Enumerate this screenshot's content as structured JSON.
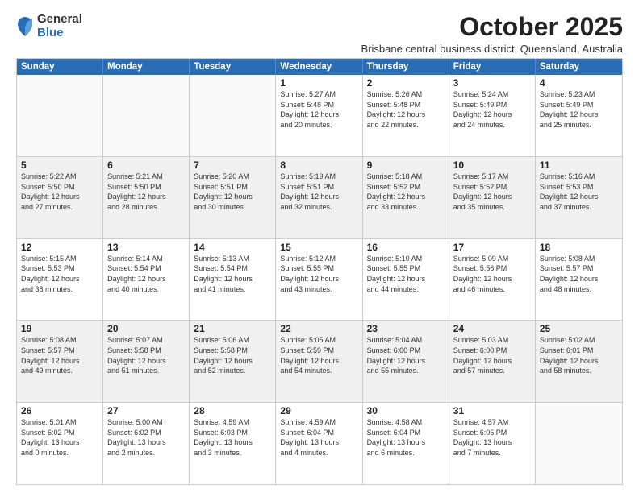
{
  "logo": {
    "general": "General",
    "blue": "Blue"
  },
  "title": "October 2025",
  "subtitle": "Brisbane central business district, Queensland, Australia",
  "header_days": [
    "Sunday",
    "Monday",
    "Tuesday",
    "Wednesday",
    "Thursday",
    "Friday",
    "Saturday"
  ],
  "weeks": [
    [
      {
        "day": "",
        "info": ""
      },
      {
        "day": "",
        "info": ""
      },
      {
        "day": "",
        "info": ""
      },
      {
        "day": "1",
        "info": "Sunrise: 5:27 AM\nSunset: 5:48 PM\nDaylight: 12 hours\nand 20 minutes."
      },
      {
        "day": "2",
        "info": "Sunrise: 5:26 AM\nSunset: 5:48 PM\nDaylight: 12 hours\nand 22 minutes."
      },
      {
        "day": "3",
        "info": "Sunrise: 5:24 AM\nSunset: 5:49 PM\nDaylight: 12 hours\nand 24 minutes."
      },
      {
        "day": "4",
        "info": "Sunrise: 5:23 AM\nSunset: 5:49 PM\nDaylight: 12 hours\nand 25 minutes."
      }
    ],
    [
      {
        "day": "5",
        "info": "Sunrise: 5:22 AM\nSunset: 5:50 PM\nDaylight: 12 hours\nand 27 minutes."
      },
      {
        "day": "6",
        "info": "Sunrise: 5:21 AM\nSunset: 5:50 PM\nDaylight: 12 hours\nand 28 minutes."
      },
      {
        "day": "7",
        "info": "Sunrise: 5:20 AM\nSunset: 5:51 PM\nDaylight: 12 hours\nand 30 minutes."
      },
      {
        "day": "8",
        "info": "Sunrise: 5:19 AM\nSunset: 5:51 PM\nDaylight: 12 hours\nand 32 minutes."
      },
      {
        "day": "9",
        "info": "Sunrise: 5:18 AM\nSunset: 5:52 PM\nDaylight: 12 hours\nand 33 minutes."
      },
      {
        "day": "10",
        "info": "Sunrise: 5:17 AM\nSunset: 5:52 PM\nDaylight: 12 hours\nand 35 minutes."
      },
      {
        "day": "11",
        "info": "Sunrise: 5:16 AM\nSunset: 5:53 PM\nDaylight: 12 hours\nand 37 minutes."
      }
    ],
    [
      {
        "day": "12",
        "info": "Sunrise: 5:15 AM\nSunset: 5:53 PM\nDaylight: 12 hours\nand 38 minutes."
      },
      {
        "day": "13",
        "info": "Sunrise: 5:14 AM\nSunset: 5:54 PM\nDaylight: 12 hours\nand 40 minutes."
      },
      {
        "day": "14",
        "info": "Sunrise: 5:13 AM\nSunset: 5:54 PM\nDaylight: 12 hours\nand 41 minutes."
      },
      {
        "day": "15",
        "info": "Sunrise: 5:12 AM\nSunset: 5:55 PM\nDaylight: 12 hours\nand 43 minutes."
      },
      {
        "day": "16",
        "info": "Sunrise: 5:10 AM\nSunset: 5:55 PM\nDaylight: 12 hours\nand 44 minutes."
      },
      {
        "day": "17",
        "info": "Sunrise: 5:09 AM\nSunset: 5:56 PM\nDaylight: 12 hours\nand 46 minutes."
      },
      {
        "day": "18",
        "info": "Sunrise: 5:08 AM\nSunset: 5:57 PM\nDaylight: 12 hours\nand 48 minutes."
      }
    ],
    [
      {
        "day": "19",
        "info": "Sunrise: 5:08 AM\nSunset: 5:57 PM\nDaylight: 12 hours\nand 49 minutes."
      },
      {
        "day": "20",
        "info": "Sunrise: 5:07 AM\nSunset: 5:58 PM\nDaylight: 12 hours\nand 51 minutes."
      },
      {
        "day": "21",
        "info": "Sunrise: 5:06 AM\nSunset: 5:58 PM\nDaylight: 12 hours\nand 52 minutes."
      },
      {
        "day": "22",
        "info": "Sunrise: 5:05 AM\nSunset: 5:59 PM\nDaylight: 12 hours\nand 54 minutes."
      },
      {
        "day": "23",
        "info": "Sunrise: 5:04 AM\nSunset: 6:00 PM\nDaylight: 12 hours\nand 55 minutes."
      },
      {
        "day": "24",
        "info": "Sunrise: 5:03 AM\nSunset: 6:00 PM\nDaylight: 12 hours\nand 57 minutes."
      },
      {
        "day": "25",
        "info": "Sunrise: 5:02 AM\nSunset: 6:01 PM\nDaylight: 12 hours\nand 58 minutes."
      }
    ],
    [
      {
        "day": "26",
        "info": "Sunrise: 5:01 AM\nSunset: 6:02 PM\nDaylight: 13 hours\nand 0 minutes."
      },
      {
        "day": "27",
        "info": "Sunrise: 5:00 AM\nSunset: 6:02 PM\nDaylight: 13 hours\nand 2 minutes."
      },
      {
        "day": "28",
        "info": "Sunrise: 4:59 AM\nSunset: 6:03 PM\nDaylight: 13 hours\nand 3 minutes."
      },
      {
        "day": "29",
        "info": "Sunrise: 4:59 AM\nSunset: 6:04 PM\nDaylight: 13 hours\nand 4 minutes."
      },
      {
        "day": "30",
        "info": "Sunrise: 4:58 AM\nSunset: 6:04 PM\nDaylight: 13 hours\nand 6 minutes."
      },
      {
        "day": "31",
        "info": "Sunrise: 4:57 AM\nSunset: 6:05 PM\nDaylight: 13 hours\nand 7 minutes."
      },
      {
        "day": "",
        "info": ""
      }
    ]
  ]
}
